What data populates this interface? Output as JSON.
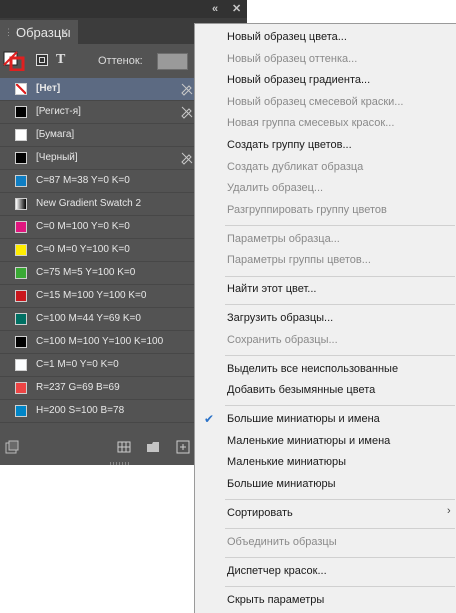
{
  "panel": {
    "tab_title": "Образцы",
    "tint_label": "Оттенок:",
    "swatches": [
      {
        "name": "[Нет]",
        "color": "none",
        "bold": true,
        "selected": true,
        "locked": true
      },
      {
        "name": "[Регист-я]",
        "color": "#000000",
        "bold": false,
        "selected": false,
        "locked": true
      },
      {
        "name": "[Бумага]",
        "color": "#ffffff",
        "bold": false,
        "selected": false,
        "locked": false
      },
      {
        "name": "[Черный]",
        "color": "#000000",
        "bold": false,
        "selected": false,
        "locked": true
      },
      {
        "name": "C=87 M=38 Y=0 K=0",
        "color": "#0f7ec3",
        "bold": false,
        "selected": false,
        "locked": false
      },
      {
        "name": "New Gradient Swatch 2",
        "color": "gradient",
        "bold": false,
        "selected": false,
        "locked": false
      },
      {
        "name": "C=0 M=100 Y=0 K=0",
        "color": "#e0177f",
        "bold": false,
        "selected": false,
        "locked": false
      },
      {
        "name": "C=0 M=0 Y=100 K=0",
        "color": "#ffed00",
        "bold": false,
        "selected": false,
        "locked": false
      },
      {
        "name": "C=75 M=5 Y=100 K=0",
        "color": "#3aa935",
        "bold": false,
        "selected": false,
        "locked": false
      },
      {
        "name": "C=15 M=100 Y=100 K=0",
        "color": "#c9171d",
        "bold": false,
        "selected": false,
        "locked": false
      },
      {
        "name": "C=100 M=44 Y=69 K=0",
        "color": "#007063",
        "bold": false,
        "selected": false,
        "locked": false
      },
      {
        "name": "C=100 M=100 Y=100 K=100",
        "color": "#000000",
        "bold": false,
        "selected": false,
        "locked": false
      },
      {
        "name": "C=1 M=0 Y=0 K=0",
        "color": "#fcfeff",
        "bold": false,
        "selected": false,
        "locked": false
      },
      {
        "name": "R=237 G=69 B=69",
        "color": "#ed4545",
        "bold": false,
        "selected": false,
        "locked": false
      },
      {
        "name": "H=200 S=100 B=78",
        "color": "#0085c7",
        "bold": false,
        "selected": false,
        "locked": false
      }
    ]
  },
  "menu": {
    "items": [
      {
        "label": "Новый образец цвета...",
        "enabled": true,
        "checked": false,
        "submenu": false
      },
      {
        "label": "Новый образец оттенка...",
        "enabled": false,
        "checked": false,
        "submenu": false
      },
      {
        "label": "Новый образец градиента...",
        "enabled": true,
        "checked": false,
        "submenu": false
      },
      {
        "label": "Новый образец смесевой краски...",
        "enabled": false,
        "checked": false,
        "submenu": false
      },
      {
        "label": "Новая группа смесевых красок...",
        "enabled": false,
        "checked": false,
        "submenu": false
      },
      {
        "label": "Создать группу цветов...",
        "enabled": true,
        "checked": false,
        "submenu": false
      },
      {
        "label": "Создать дубликат образца",
        "enabled": false,
        "checked": false,
        "submenu": false
      },
      {
        "label": "Удалить образец...",
        "enabled": false,
        "checked": false,
        "submenu": false
      },
      {
        "label": "Разгруппировать группу цветов",
        "enabled": false,
        "checked": false,
        "submenu": false
      },
      {
        "separator": true
      },
      {
        "label": "Параметры образца...",
        "enabled": false,
        "checked": false,
        "submenu": false
      },
      {
        "label": "Параметры группы цветов...",
        "enabled": false,
        "checked": false,
        "submenu": false
      },
      {
        "separator": true
      },
      {
        "label": "Найти этот цвет...",
        "enabled": true,
        "checked": false,
        "submenu": false
      },
      {
        "separator": true
      },
      {
        "label": "Загрузить образцы...",
        "enabled": true,
        "checked": false,
        "submenu": false
      },
      {
        "label": "Сохранить образцы...",
        "enabled": false,
        "checked": false,
        "submenu": false
      },
      {
        "separator": true
      },
      {
        "label": "Выделить все неиспользованные",
        "enabled": true,
        "checked": false,
        "submenu": false
      },
      {
        "label": "Добавить безымянные цвета",
        "enabled": true,
        "checked": false,
        "submenu": false
      },
      {
        "separator": true
      },
      {
        "label": "Большие миниатюры и имена",
        "enabled": true,
        "checked": true,
        "submenu": false
      },
      {
        "label": "Маленькие миниатюры и имена",
        "enabled": true,
        "checked": false,
        "submenu": false
      },
      {
        "label": "Маленькие миниатюры",
        "enabled": true,
        "checked": false,
        "submenu": false
      },
      {
        "label": "Большие миниатюры",
        "enabled": true,
        "checked": false,
        "submenu": false
      },
      {
        "separator": true
      },
      {
        "label": "Сортировать",
        "enabled": true,
        "checked": false,
        "submenu": true
      },
      {
        "separator": true
      },
      {
        "label": "Объединить образцы",
        "enabled": false,
        "checked": false,
        "submenu": false
      },
      {
        "separator": true
      },
      {
        "label": "Диспетчер красок...",
        "enabled": true,
        "checked": false,
        "submenu": false
      },
      {
        "separator": true
      },
      {
        "label": "Скрыть параметры",
        "enabled": true,
        "checked": false,
        "submenu": false
      }
    ]
  }
}
